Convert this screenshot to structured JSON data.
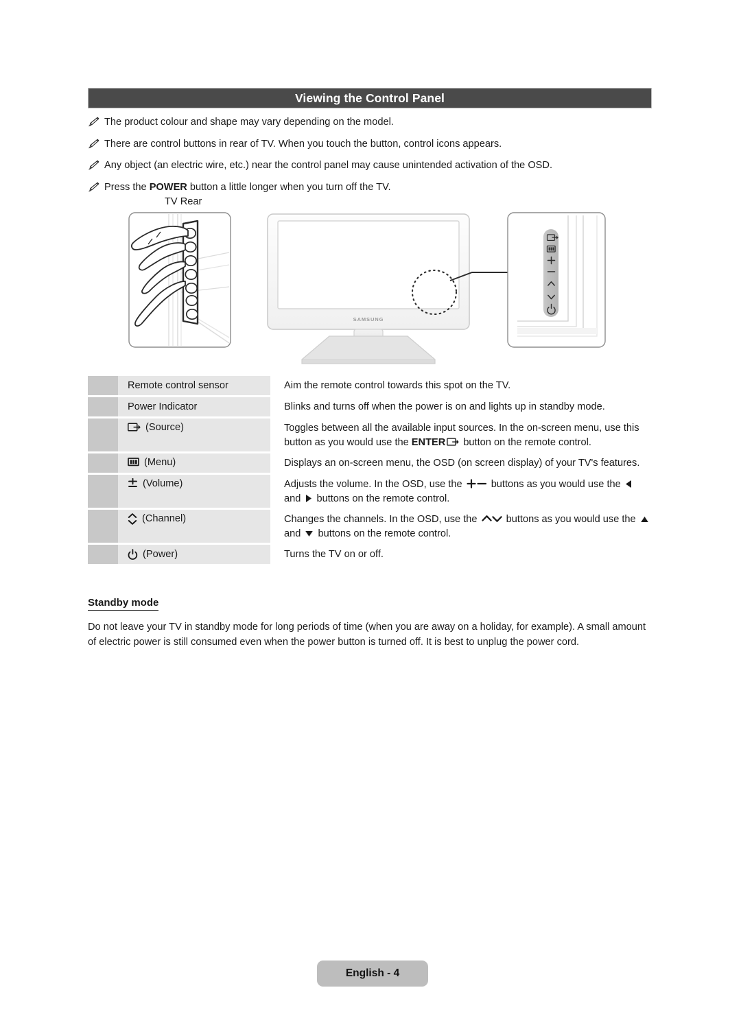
{
  "header": {
    "title": "Viewing the Control Panel"
  },
  "notes": [
    {
      "icon": "pencil-icon",
      "text": "The product colour and shape may vary depending on the model."
    },
    {
      "icon": "pencil-icon",
      "text": "There are control buttons in rear of TV. When you touch the button, control icons appears."
    },
    {
      "icon": "pencil-icon",
      "text": "Any object (an electric wire, etc.) near the control panel may cause unintended activation of the OSD."
    },
    {
      "icon": "pencil-icon",
      "pre": "Press the ",
      "strong": "POWER",
      "post": " button a little longer when you turn off the TV."
    }
  ],
  "figure": {
    "tv_rear_label": "TV Rear",
    "brand_logo": "SAMSUNG",
    "panel_icons": [
      "source-icon",
      "menu-icon",
      "plus-icon",
      "minus-icon",
      "chevron-up-icon",
      "chevron-down-icon",
      "power-icon"
    ],
    "rear_button_count": 7
  },
  "table": {
    "rows": [
      {
        "icon": null,
        "label": "Remote control sensor",
        "desc_parts": [
          {
            "t": "Aim the remote control towards this spot on the TV."
          }
        ]
      },
      {
        "icon": null,
        "label": "Power Indicator",
        "desc_parts": [
          {
            "t": "Blinks and turns off when the power is on and lights up in standby mode."
          }
        ]
      },
      {
        "icon": "source-icon",
        "label": "(Source)",
        "desc_parts": [
          {
            "t": "Toggles between all the available input sources. In the on-screen menu, use this button as you would use the "
          },
          {
            "t": "ENTER",
            "bold": true
          },
          {
            "icon": "source-icon"
          },
          {
            "t": " button on the remote control."
          }
        ]
      },
      {
        "icon": "menu-icon",
        "label": "(Menu)",
        "desc_parts": [
          {
            "t": "Displays an on-screen menu, the OSD (on screen display) of your TV's features."
          }
        ]
      },
      {
        "icon": "volume-icon",
        "label": "(Volume)",
        "desc_parts": [
          {
            "t": "Adjusts the volume. In the OSD, use the "
          },
          {
            "icon": "plus-minus-icon"
          },
          {
            "t": " buttons as you would use the "
          },
          {
            "icon": "triangle-left-icon"
          },
          {
            "t": " and "
          },
          {
            "icon": "triangle-right-icon"
          },
          {
            "t": " buttons on the remote control."
          }
        ]
      },
      {
        "icon": "channel-icon",
        "label": "(Channel)",
        "desc_parts": [
          {
            "t": "Changes the channels. In the OSD, use the "
          },
          {
            "icon": "chevron-up-down-icon"
          },
          {
            "t": " buttons as you would use the "
          },
          {
            "icon": "triangle-up-icon"
          },
          {
            "t": " and "
          },
          {
            "icon": "triangle-down-icon"
          },
          {
            "t": " buttons on the remote control."
          }
        ]
      },
      {
        "icon": "power-icon",
        "label": "(Power)",
        "desc_parts": [
          {
            "t": "Turns the TV on or off."
          }
        ]
      }
    ]
  },
  "standby": {
    "heading": "Standby mode",
    "body": "Do not leave your TV in standby mode for long periods of time (when you are away on a holiday, for example). A small amount of electric power is still consumed even when the power button is turned off. It is best to unplug the power cord."
  },
  "footer": {
    "page_label": "English - 4"
  },
  "colors": {
    "header_bar": "#4a4a4a",
    "swatch": "#c8c8c8",
    "label_cell": "#e6e6e6",
    "footer_pill": "#bdbdbd",
    "text": "#1a1a1a"
  }
}
